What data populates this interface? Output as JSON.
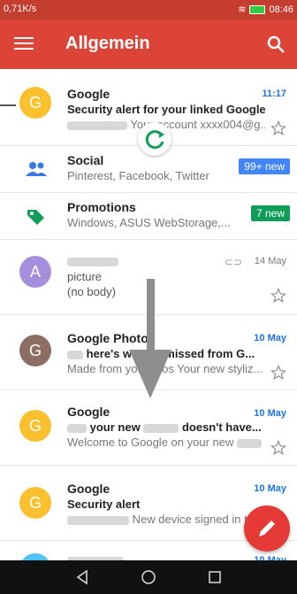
{
  "status": {
    "left": "0,71K/s",
    "time": "08:46"
  },
  "appbar": {
    "title": "Allgemein"
  },
  "emails": [
    {
      "avatar_letter": "G",
      "avatar_color": "#fbc02d",
      "sender": "Google",
      "subject": "Security alert for your linked Google...",
      "snippet": "Your account xxxx004@g...",
      "time": "11:17"
    },
    {
      "avatar_letter": "A",
      "avatar_color": "#a58fdc",
      "sender": "",
      "subject": "picture",
      "snippet": "(no body)",
      "time": "14 May"
    },
    {
      "avatar_letter": "G",
      "avatar_color": "#8d6e63",
      "sender": "Google Photo",
      "subject": "here's w",
      "subject_end": "ou missed from G...",
      "snippet": "Made from you",
      "snippet_end": "otos Your new styliz...",
      "time": "10 May"
    },
    {
      "avatar_letter": "G",
      "avatar_color": "#fbc02d",
      "sender": "Google",
      "subject": "your new",
      "subject_end": "doesn't have...",
      "snippet": "Welcome to Google on your new",
      "time": "10 May"
    },
    {
      "avatar_letter": "G",
      "avatar_color": "#fbc02d",
      "sender": "Google",
      "subject": "Security alert",
      "snippet": "New device signed in to",
      "time": "10 May"
    },
    {
      "avatar_letter": "G",
      "avatar_color": "#4fc3f7",
      "sender": "",
      "subject": "",
      "snippet": "",
      "time": "10 May"
    }
  ],
  "categories": [
    {
      "name": "Social",
      "snippet": "Pinterest, Facebook, Twitter",
      "badge": "99+ new",
      "badge_color": "#4285f4",
      "icon": "people-icon"
    },
    {
      "name": "Promotions",
      "snippet": "Windows, ASUS WebStorage,...",
      "badge": "7 new",
      "badge_color": "#0f9d58",
      "icon": "tag-icon"
    }
  ],
  "colors": {
    "appbar": "#db4437",
    "statusbar": "#c43d2f",
    "accent_blue": "#1a73e8"
  }
}
